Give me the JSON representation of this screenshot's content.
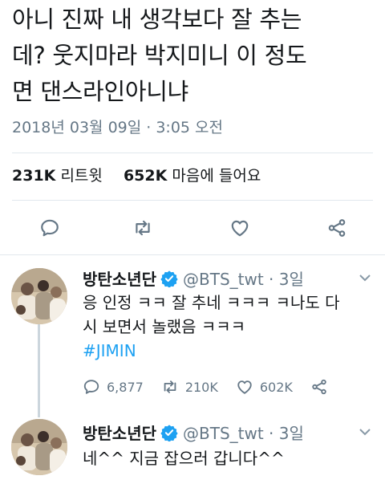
{
  "tweet": {
    "text_lines": [
      "아니 진짜 내 생각보다 잘 추는",
      "데? 웃지마라 박지미니 이 정도",
      "면 댄스라인아니냐"
    ],
    "timestamp": "2018년 03월 09일 · 3:05 오전",
    "retweets_count": "231K",
    "retweets_label": "리트윗",
    "likes_count": "652K",
    "likes_label": "마음에 들어요"
  },
  "actions": {
    "icons": [
      "reply-icon",
      "retweet-icon",
      "like-icon",
      "share-icon"
    ]
  },
  "replies": [
    {
      "name": "방탄소년단",
      "handle": "@BTS_twt · 3일",
      "text_lines": [
        "응 인정 ㅋㅋ 잘 추네 ㅋㅋㅋ ㅋ나도 다",
        "시 보면서 놀랬음 ㅋㅋㅋ"
      ],
      "hashtag": "#JIMIN",
      "reply_count": "6,877",
      "retweet_count": "210K",
      "like_count": "602K"
    },
    {
      "name": "방탄소년단",
      "handle": "@BTS_twt · 3일",
      "text_lines": [
        "네^^ 지금 잡으러 갑니다^^"
      ]
    }
  ],
  "colors": {
    "text": "#14171a",
    "secondary": "#657786",
    "link": "#1da1f2",
    "divider": "#e1e8ed"
  }
}
